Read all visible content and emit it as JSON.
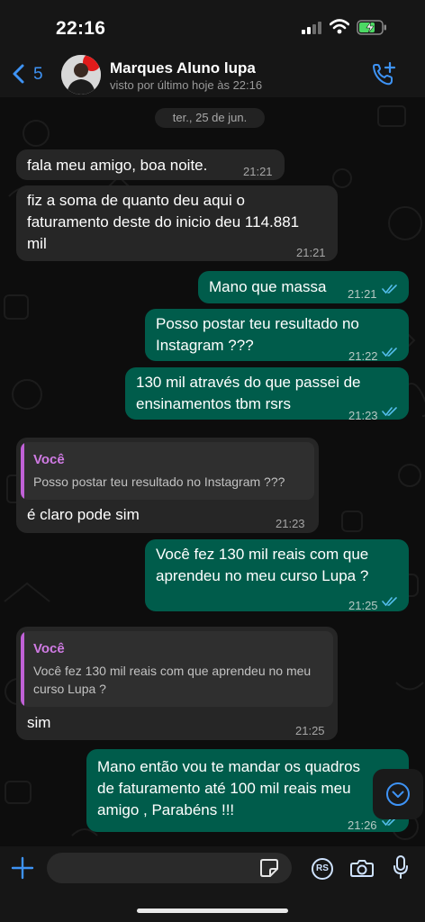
{
  "status_bar": {
    "time": "22:16"
  },
  "header": {
    "back_count": "5",
    "contact_name": "Marques Aluno lupa",
    "contact_status": "visto por último hoje às 22:16"
  },
  "chat": {
    "date_label": "ter., 25 de jun.",
    "messages": [
      {
        "dir": "in",
        "text": "fala meu amigo, boa noite.",
        "time": "21:21"
      },
      {
        "dir": "in",
        "text": "fiz a soma de quanto deu aqui o\nfaturamento deste do inicio deu 114.881\nmil",
        "time": "21:21"
      },
      {
        "dir": "out",
        "text": "Mano que massa",
        "time": "21:21",
        "read": true
      },
      {
        "dir": "out",
        "text": "Posso postar teu resultado no\nInstagram ???",
        "time": "21:22",
        "read": true
      },
      {
        "dir": "out",
        "text": "130 mil através do que passei de\nensinamentos tbm rsrs",
        "time": "21:23",
        "read": true
      },
      {
        "dir": "in",
        "quote_author": "Você",
        "quote_text": "Posso postar teu resultado no Instagram ???",
        "text": "é claro pode sim",
        "time": "21:23"
      },
      {
        "dir": "out",
        "text": "Você fez 130 mil reais com que\naprendeu no meu curso Lupa ?",
        "time": "21:25",
        "read": true
      },
      {
        "dir": "in",
        "quote_author": "Você",
        "quote_text": "Você fez 130 mil reais com que aprendeu no meu\ncurso Lupa ?",
        "text": "sim",
        "time": "21:25"
      },
      {
        "dir": "out",
        "text": "Mano então vou te mandar os quadros\nde faturamento até 100 mil reais meu\namigo , Parabéns !!!",
        "time": "21:26",
        "read": true
      }
    ]
  },
  "composer": {
    "rs_label": "RS"
  },
  "colors": {
    "accent": "#3e93f5",
    "outgoing_bubble": "#005c4b",
    "incoming_bubble": "#262626",
    "quote_name": "#d07be4",
    "read_tick": "#53bdeb"
  }
}
